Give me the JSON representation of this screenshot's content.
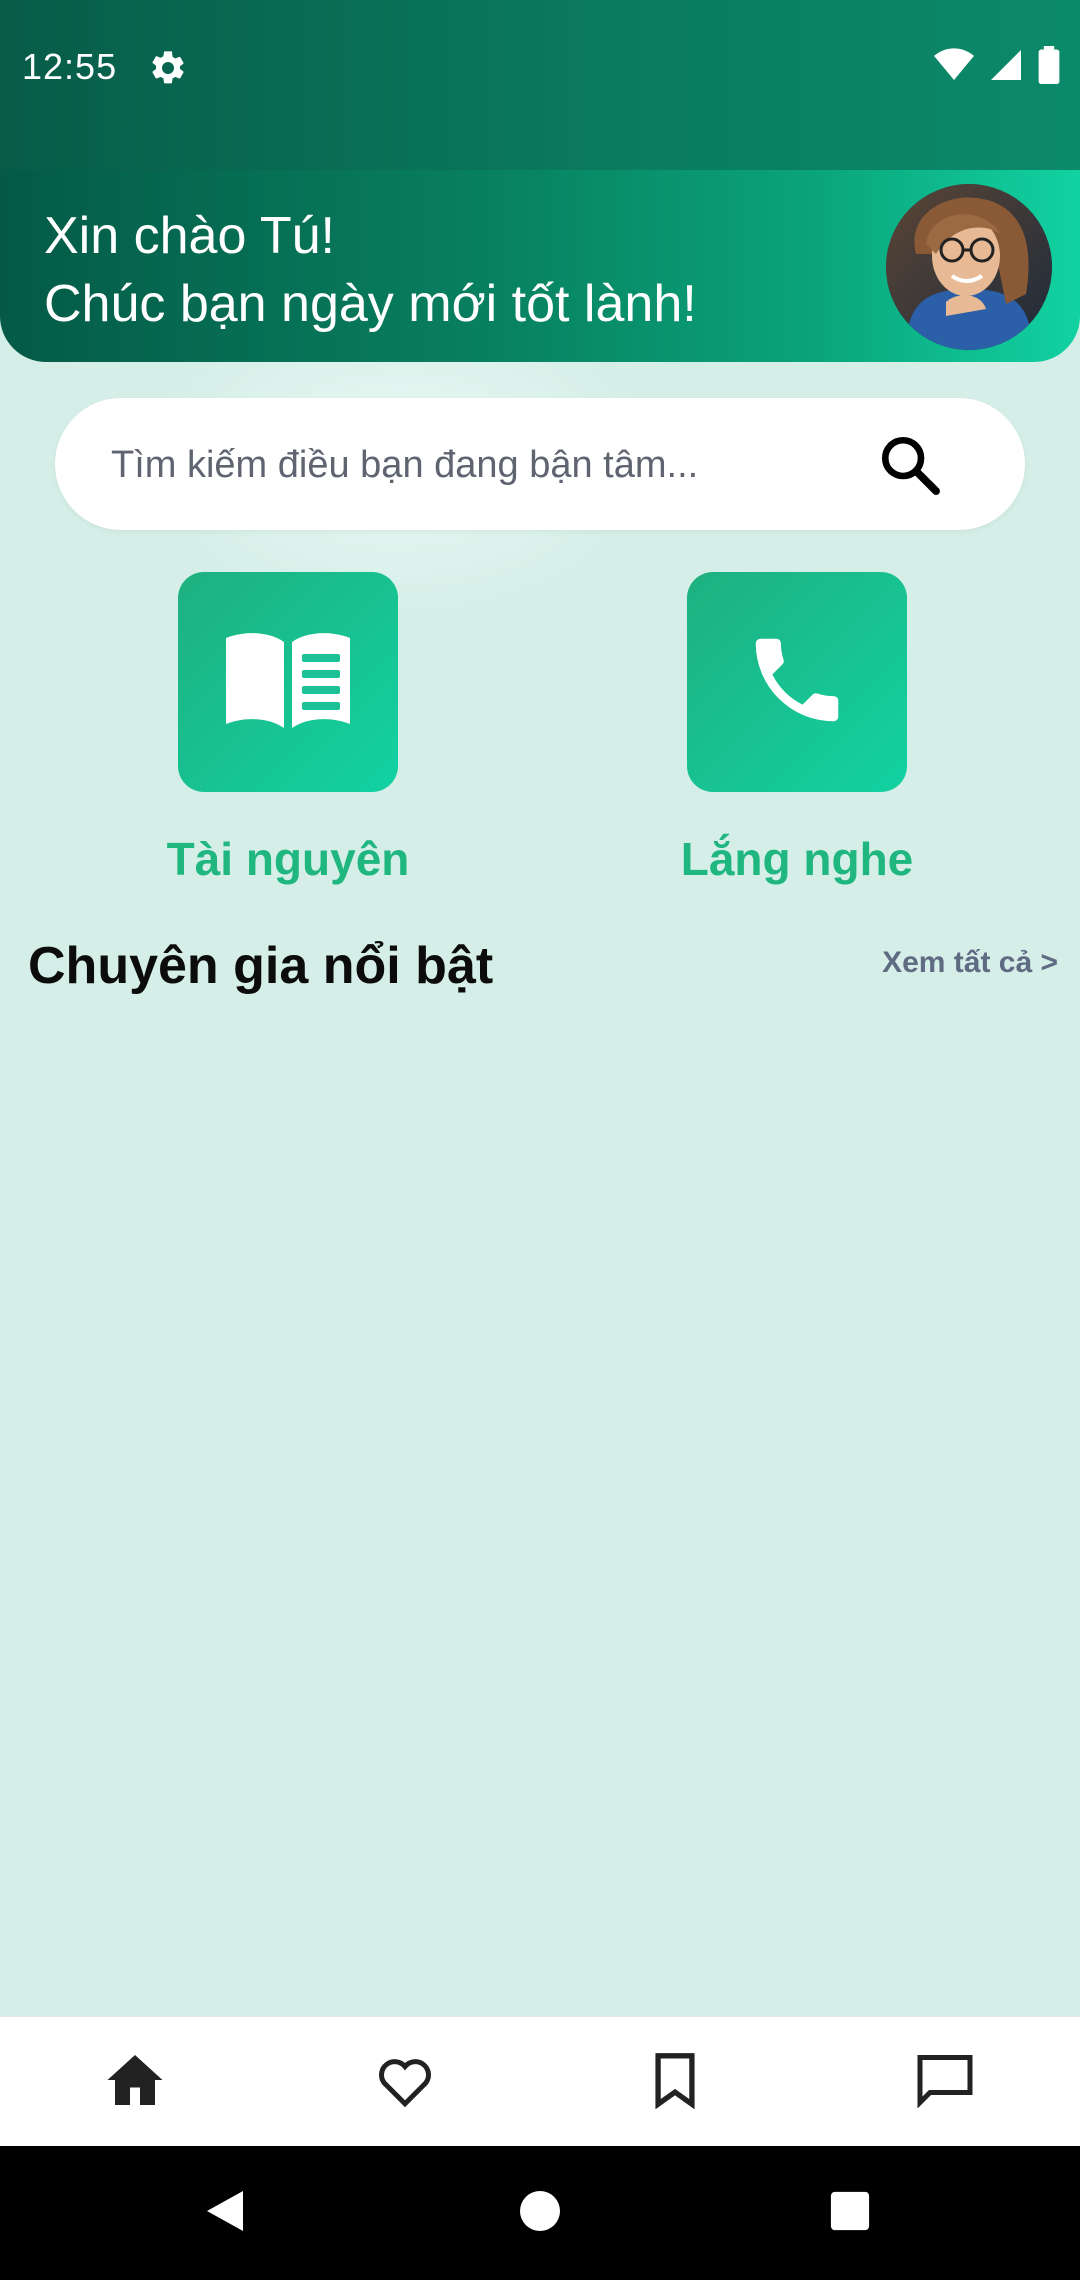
{
  "status_bar": {
    "time": "12:55",
    "icons": [
      "gear-icon",
      "wifi-icon",
      "signal-icon",
      "battery-icon"
    ]
  },
  "header": {
    "greeting_line1": "Xin chào Tú!",
    "greeting_line2": "Chúc bạn ngày mới tốt lành!"
  },
  "search": {
    "placeholder": "Tìm kiếm điều bạn đang bận tâm..."
  },
  "quick_actions": [
    {
      "label": "Tài nguyên",
      "icon": "book-icon"
    },
    {
      "label": "Lắng nghe",
      "icon": "phone-icon"
    }
  ],
  "featured": {
    "title": "Chuyên gia nổi bật",
    "see_all": "Xem tất cả >"
  },
  "bottom_nav": {
    "items": [
      {
        "icon": "home-icon"
      },
      {
        "icon": "heart-icon"
      },
      {
        "icon": "bookmark-icon"
      },
      {
        "icon": "chat-icon"
      }
    ]
  },
  "colors": {
    "accent": "#1fb77f",
    "header_dark": "#045a47",
    "header_light": "#12d2a2",
    "background": "#d5efe8"
  }
}
